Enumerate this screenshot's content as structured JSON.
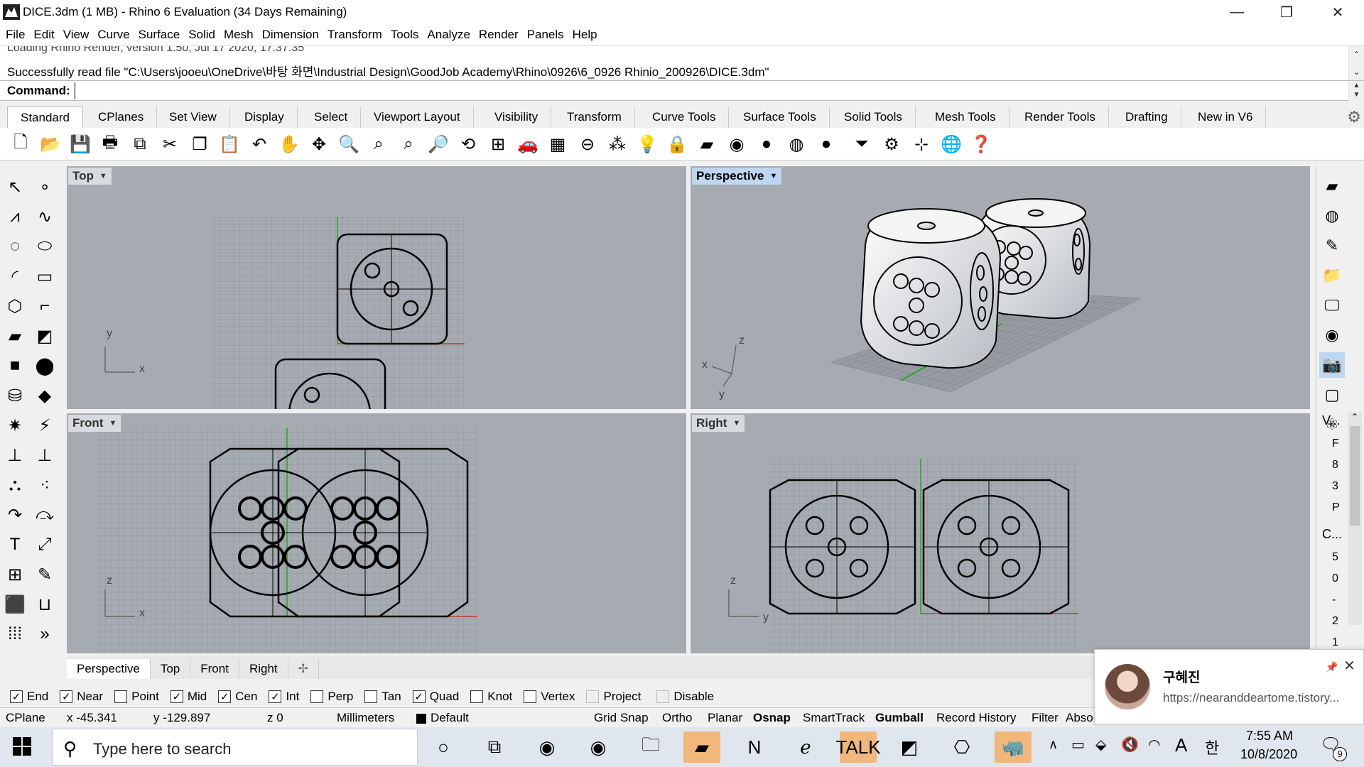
{
  "window": {
    "title": "DICE.3dm (1 MB) - Rhino 6 Evaluation (34 Days Remaining)",
    "minimize": "—",
    "restore": "❐",
    "close": "✕"
  },
  "menu": [
    "File",
    "Edit",
    "View",
    "Curve",
    "Surface",
    "Solid",
    "Mesh",
    "Dimension",
    "Transform",
    "Tools",
    "Analyze",
    "Render",
    "Panels",
    "Help"
  ],
  "command_history": {
    "line1": "Loading Rhino Render, version 1.50, Jul 17 2020, 17:37:35",
    "line2": "Successfully read file \"C:\\Users\\jooeu\\OneDrive\\바탕 화면\\Industrial Design\\GoodJob Academy\\Rhino\\0926\\6_0926 Rhinio_200926\\DICE.3dm\""
  },
  "command": {
    "label": "Command:",
    "value": ""
  },
  "toolbar_tabs": [
    "Standard",
    "CPlanes",
    "Set View",
    "Display",
    "Select",
    "Viewport Layout",
    "Visibility",
    "Transform",
    "Curve Tools",
    "Surface Tools",
    "Solid Tools",
    "Mesh Tools",
    "Render Tools",
    "Drafting",
    "New in V6"
  ],
  "active_tab": "Standard",
  "viewports": {
    "top": "Top",
    "perspective": "Perspective",
    "front": "Front",
    "right": "Right"
  },
  "viewport_tabs": [
    "Perspective",
    "Top",
    "Front",
    "Right"
  ],
  "viewport_tab_add": "✢",
  "osnaps": [
    {
      "label": "End",
      "checked": true
    },
    {
      "label": "Near",
      "checked": true
    },
    {
      "label": "Point",
      "checked": false
    },
    {
      "label": "Mid",
      "checked": true
    },
    {
      "label": "Cen",
      "checked": true
    },
    {
      "label": "Int",
      "checked": true
    },
    {
      "label": "Perp",
      "checked": false
    },
    {
      "label": "Tan",
      "checked": false
    },
    {
      "label": "Quad",
      "checked": true
    },
    {
      "label": "Knot",
      "checked": false
    },
    {
      "label": "Vertex",
      "checked": false
    },
    {
      "label": "Project",
      "checked": false
    },
    {
      "label": "Disable",
      "checked": false
    }
  ],
  "status": {
    "cplane": "CPlane",
    "x": "x -45.341",
    "y": "y -129.897",
    "z": "z 0",
    "units": "Millimeters",
    "layer": "Default",
    "grid_snap": "Grid Snap",
    "ortho": "Ortho",
    "planar": "Planar",
    "osnap": "Osnap",
    "smarttrack": "SmartTrack",
    "gumball": "Gumball",
    "record_history": "Record History",
    "filter": "Filter",
    "abso": "Abso"
  },
  "right_panel": {
    "label_v": "V...",
    "label_c": "C...",
    "items": [
      "F",
      "8",
      "3",
      "P",
      "5",
      "0",
      "-",
      "2",
      "1"
    ]
  },
  "notification": {
    "name": "구혜진",
    "url": "https://nearanddeartome.tistory...",
    "pin": "📌",
    "close": "✕"
  },
  "taskbar": {
    "search_placeholder": "Type here to search",
    "time": "7:55 AM",
    "date": "10/8/2020",
    "ime": "한",
    "lang": "A",
    "notif_count": "9"
  },
  "colors": {
    "viewport_bg": "#a6abb1",
    "grid_line": "#8d9298",
    "x_axis": "#c0392b",
    "y_axis": "#2ca02c",
    "active_label": "#bfd6f0",
    "taskbar_bg": "#dfe6ee",
    "taskbar_highlight": "#f2b77b"
  }
}
